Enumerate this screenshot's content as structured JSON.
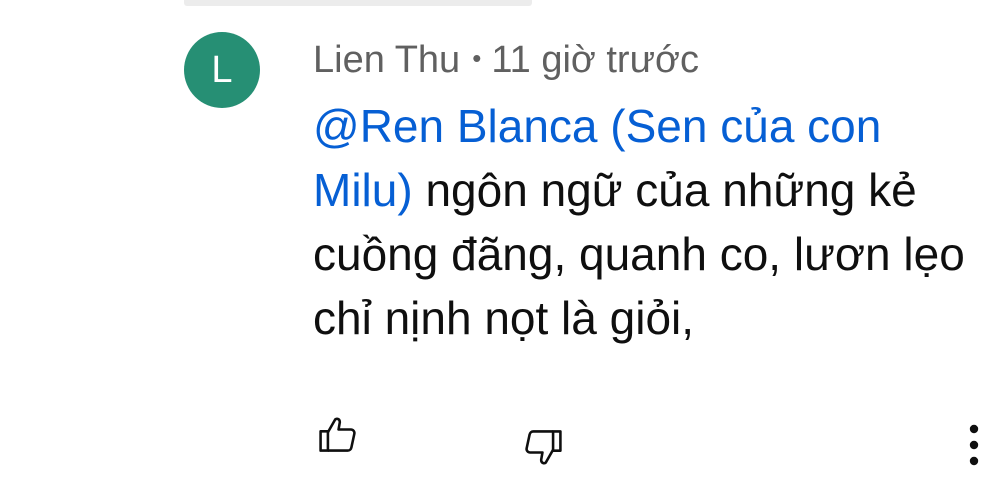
{
  "comment": {
    "avatar_letter": "L",
    "avatar_color": "#268f74",
    "author": "Lien Thu",
    "separator": "•",
    "time": "11 giờ trước",
    "mention": " @Ren Blanca (Sen của con Milu)",
    "text": "  ngôn ngữ của những kẻ cuồng đãng, quanh co, lươn lẹo chỉ nịnh nọt là giỏi,",
    "mention_color": "#065fd4"
  },
  "actions": {
    "like_icon": "thumb-up-icon",
    "dislike_icon": "thumb-down-icon",
    "more_icon": "more-vertical-icon"
  }
}
